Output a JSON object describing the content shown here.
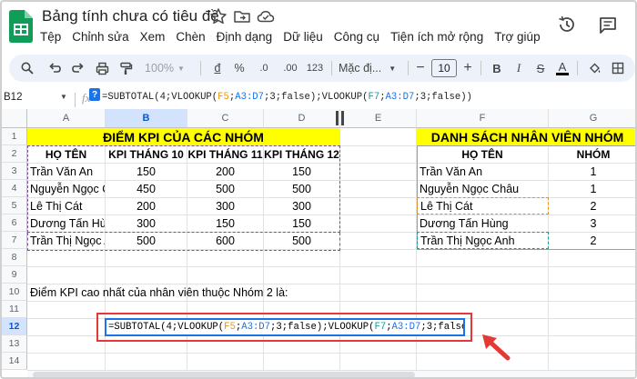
{
  "app": {
    "title": "Bảng tính chưa có tiêu đề",
    "menu": [
      "Tệp",
      "Chỉnh sửa",
      "Xem",
      "Chèn",
      "Định dạng",
      "Dữ liệu",
      "Công cụ",
      "Tiện ích mở rộng",
      "Trợ giúp"
    ]
  },
  "toolbar": {
    "zoom": "100%",
    "currency": "đ",
    "percent": "%",
    "dec_decrease": ".0",
    "dec_increase": ".00",
    "number_format": "123",
    "font": "Mặc đị...",
    "font_size": "10",
    "bold": "B",
    "italic": "I",
    "strike": "S",
    "text_color": "A"
  },
  "formula_bar": {
    "cell_ref": "B12",
    "fx": "fx",
    "parts": [
      "=SUBTOTAL(4;VLOOKUP(",
      "F5",
      ";",
      "A3:D7",
      ";3;false);VLOOKUP(",
      "F7",
      ";",
      "A3:D7",
      ";3;false))"
    ]
  },
  "grid": {
    "columns": [
      "A",
      "B",
      "C",
      "D",
      "E",
      "F",
      "G"
    ],
    "rows": [
      "1",
      "2",
      "3",
      "4",
      "5",
      "6",
      "7",
      "8",
      "9",
      "10",
      "11",
      "12",
      "13",
      "14"
    ]
  },
  "kpi_table": {
    "title": "ĐIỂM KPI CỦA CÁC NHÓM",
    "headers": [
      "HỌ TÊN",
      "KPI THÁNG 10",
      "KPI THÁNG 11",
      "KPI THÁNG 12"
    ],
    "rows": [
      [
        "Trần Văn An",
        "150",
        "200",
        "150"
      ],
      [
        "Nguyễn Ngọc Ch",
        "450",
        "500",
        "500"
      ],
      [
        "Lê Thị Cát",
        "200",
        "300",
        "300"
      ],
      [
        "Dương Tấn Hùng",
        "300",
        "150",
        "150"
      ],
      [
        "Trần Thị Ngọc Ar",
        "500",
        "600",
        "500"
      ]
    ]
  },
  "group_table": {
    "title": "DANH SÁCH NHÂN VIÊN NHÓM",
    "headers": [
      "HỌ TÊN",
      "NHÓM"
    ],
    "rows": [
      [
        "Trần Văn An",
        "1"
      ],
      [
        "Nguyễn Ngọc Châu",
        "1"
      ],
      [
        "Lê Thị Cát",
        "2"
      ],
      [
        "Dương Tấn Hùng",
        "3"
      ],
      [
        "Trần Thị Ngọc Anh",
        "2"
      ]
    ]
  },
  "question": "Điểm KPI cao nhất của nhân viên thuộc Nhóm 2 là:",
  "editing_cell": {
    "parts": [
      "=SUBTOTAL(4;VLOOKUP(",
      "F5",
      ";",
      "A3:D7",
      ";3;false);VLOOKUP(",
      "F7",
      ";",
      "A3:D7",
      ";3;false))"
    ]
  },
  "colors": {
    "title_fill": "#ffff00",
    "highlight_box": "#e53935",
    "arrow": "#e53935",
    "ref_f5": "#f09300",
    "ref_range": "#1a73e8",
    "ref_f7": "#0f9d9a",
    "accent": "#1a73e8"
  }
}
